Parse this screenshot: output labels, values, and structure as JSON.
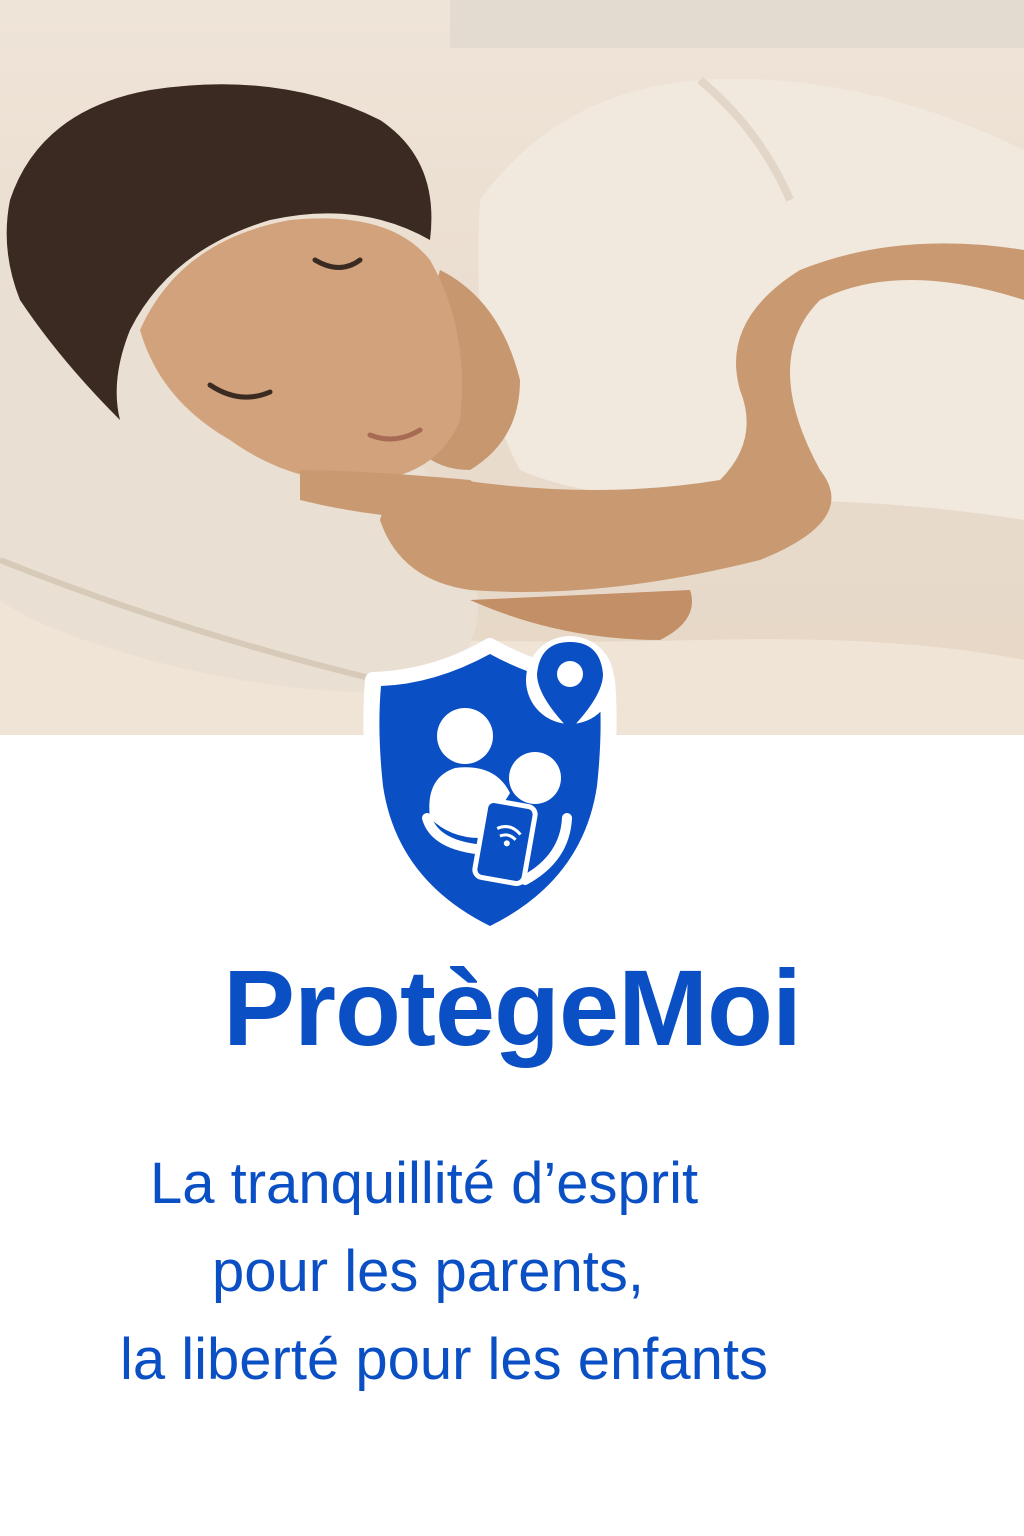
{
  "hero": {
    "icon": "sleeping-person-photo"
  },
  "logo": {
    "icon": "shield-family-location-icon",
    "color": "#0a4fc4"
  },
  "brand": {
    "name": "ProtègeMoi"
  },
  "tagline": {
    "line1": "La tranquillité d’esprit",
    "line2": "pour les parents,",
    "line3": "la liberté pour les enfants"
  },
  "colors": {
    "accent": "#0a4fc4",
    "background": "#ffffff"
  }
}
